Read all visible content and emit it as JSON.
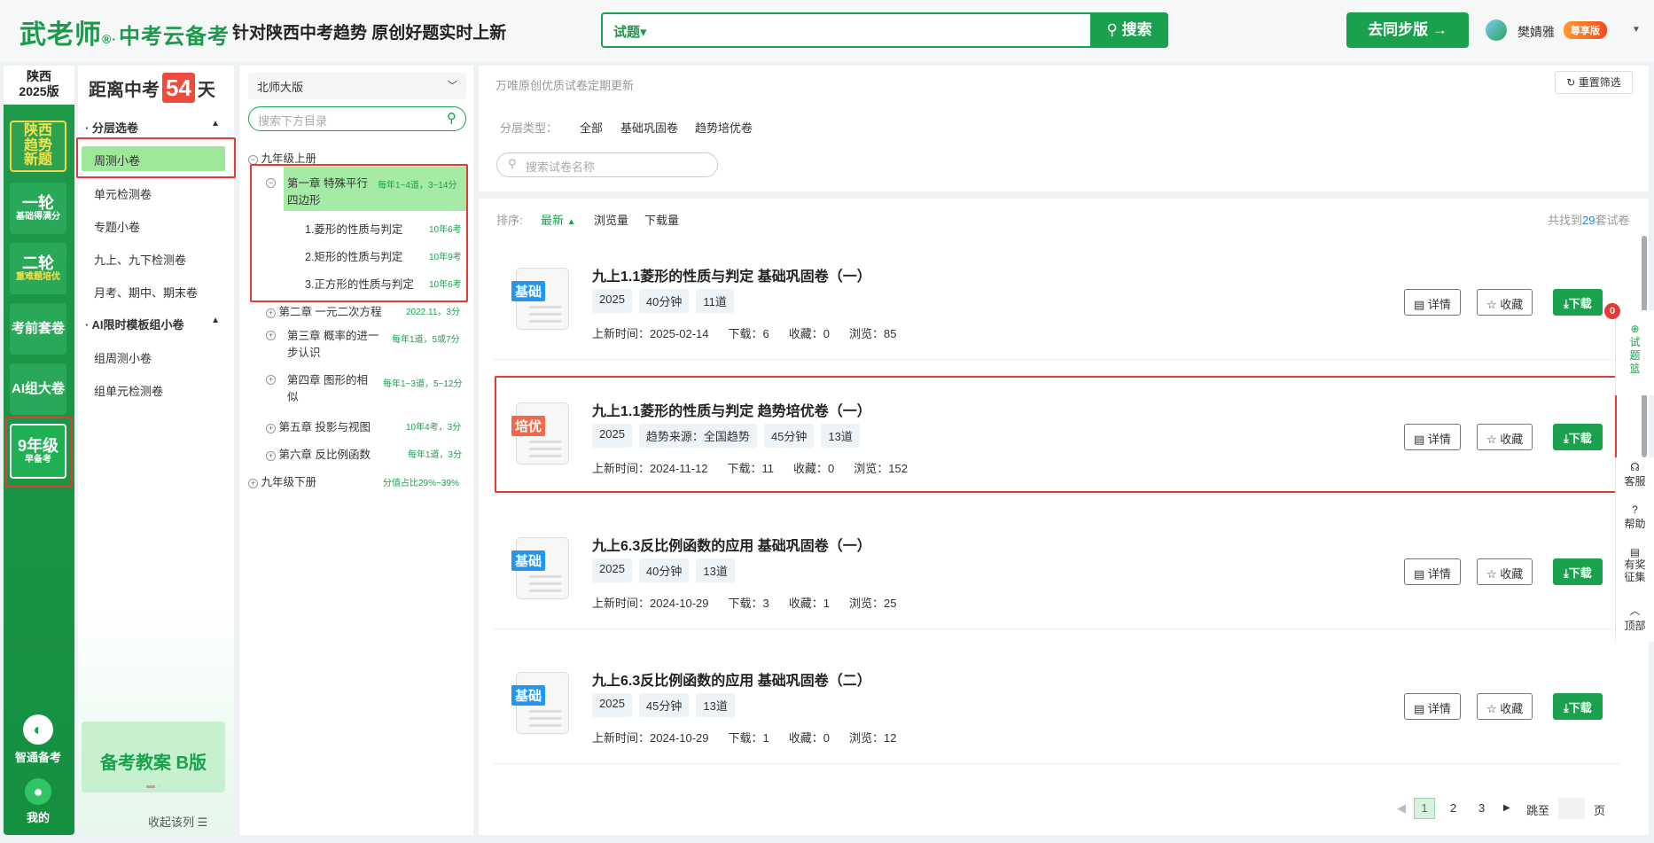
{
  "header": {
    "logo_main": "武老师",
    "logo_dot": "®·",
    "logo_sub": "中考云备考",
    "slogan": "针对陕西中考趋势 原创好题实时上新",
    "search_type": "试题▾",
    "search_button": "搜索",
    "sync_button": "去同步版 →",
    "username": "樊婧雅",
    "vip_badge": "尊享版"
  },
  "left_nav": {
    "edition_line1": "陕西",
    "edition_line2": "2025版",
    "items": [
      {
        "big": "陕西\n趋势\n新题",
        "small": ""
      },
      {
        "big": "一轮",
        "small": "基础得满分"
      },
      {
        "big": "二轮",
        "small": "重难题培优"
      },
      {
        "big": "考前套卷",
        "small": ""
      },
      {
        "big": "AI组大卷",
        "small": ""
      },
      {
        "big": "9年级",
        "small": "早备考"
      }
    ],
    "bottom1": "智通备考",
    "bottom2": "我的"
  },
  "panel2": {
    "countdown_prefix": "距离中考",
    "countdown_days": "54",
    "countdown_suffix": "天",
    "sections": [
      {
        "title": "分层选卷",
        "items": [
          "周测小卷",
          "单元检测卷",
          "专题小卷",
          "九上、九下检测卷",
          "月考、期中、期末卷"
        ]
      },
      {
        "title": "AI限时模板组小卷",
        "items": [
          "组周测小卷",
          "组单元检测卷"
        ]
      }
    ],
    "promo": "备考教案 B版",
    "collapse": "收起该列 ☰"
  },
  "tree": {
    "version": "北师大版",
    "search_placeholder": "搜索下方目录",
    "root1": "九年级上册",
    "ch1_line1": "第一章 特殊平行",
    "ch1_line2": "四边形",
    "ch1_note": "每年1~4道，3~14分",
    "sections": [
      {
        "label": "1.菱形的性质与判定",
        "note": "10年6考"
      },
      {
        "label": "2.矩形的性质与判定",
        "note": "10年9考"
      },
      {
        "label": "3.正方形的性质与判定",
        "note": "10年6考"
      }
    ],
    "ch2": "第二章 一元二次方程",
    "ch2_note": "2022.11，3分",
    "ch3_line1": "第三章 概率的进一",
    "ch3_line2": "步认识",
    "ch3_note": "每年1道，5或7分",
    "ch4_line1": "第四章 图形的相",
    "ch4_line2": "似",
    "ch4_note": "每年1~3道，5~12分",
    "ch5": "第五章 投影与视图",
    "ch5_note": "10年4考，3分",
    "ch6": "第六章 反比例函数",
    "ch6_note": "每年1道，3分",
    "root2": "九年级下册",
    "root2_note": "分值占比29%~39%"
  },
  "filter": {
    "note": "万唯原创优质试卷定期更新",
    "reset": "重置筛选",
    "layer_label": "分层类型：",
    "layer_options": [
      "全部",
      "基础巩固卷",
      "趋势培优卷"
    ],
    "name_placeholder": "搜索试卷名称"
  },
  "list": {
    "sort_label": "排序:",
    "sort_options": [
      "最新",
      "浏览量",
      "下载量"
    ],
    "found_prefix": "共找到",
    "found_count": "29",
    "found_suffix": "套试卷",
    "papers": [
      {
        "tag": "基础",
        "title": "九上1.1菱形的性质与判定 基础巩固卷（一）",
        "chips": [
          "2025",
          "40分钟",
          "11道"
        ],
        "date": "上新时间：2025-02-14",
        "downloads": "下载：6",
        "favorites": "收藏：0",
        "views": "浏览：85"
      },
      {
        "tag": "培优",
        "title": "九上1.1菱形的性质与判定 趋势培优卷（一）",
        "chips": [
          "2025",
          "趋势来源：全国趋势",
          "45分钟",
          "13道"
        ],
        "date": "上新时间：2024-11-12",
        "downloads": "下载：11",
        "favorites": "收藏：0",
        "views": "浏览：152"
      },
      {
        "tag": "基础",
        "title": "九上6.3反比例函数的应用 基础巩固卷（一）",
        "chips": [
          "2025",
          "40分钟",
          "13道"
        ],
        "date": "上新时间：2024-10-29",
        "downloads": "下载：3",
        "favorites": "收藏：1",
        "views": "浏览：25"
      },
      {
        "tag": "基础",
        "title": "九上6.3反比例函数的应用 基础巩固卷（二）",
        "chips": [
          "2025",
          "45分钟",
          "13道"
        ],
        "date": "上新时间：2024-10-29",
        "downloads": "下载：1",
        "favorites": "收藏：0",
        "views": "浏览：12"
      }
    ],
    "btn_detail": "详情",
    "btn_fav": "收藏",
    "btn_download": "下载"
  },
  "pager": {
    "pages": [
      "1",
      "2",
      "3"
    ],
    "jump_label": "跳至",
    "page_suffix": "页"
  },
  "side_tools": {
    "basket": "试\n题\n篮",
    "basket_count": "0",
    "service": "客服",
    "help": "帮助",
    "reward": "有奖\n征集",
    "top": "顶部"
  },
  "colors": {
    "brand": "#1aa14d",
    "highlight_box": "#e53935"
  }
}
